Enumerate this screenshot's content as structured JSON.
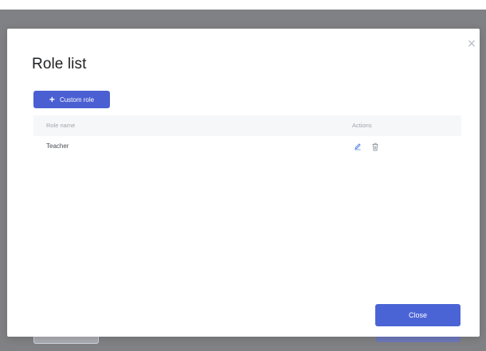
{
  "dialog": {
    "title": "Role list",
    "close_symbol": "×",
    "add_button": {
      "icon": "plus-icon",
      "label": "Custom role"
    },
    "table": {
      "columns": [
        "Role name",
        "Actions"
      ],
      "rows": [
        {
          "name": "Teacher",
          "actions": [
            "edit-icon",
            "delete-icon"
          ]
        }
      ]
    },
    "footer": {
      "close_label": "Close"
    }
  },
  "colors": {
    "overlay": "#808184",
    "primary": "#4a5fd2",
    "header_bg": "#f6f7f9",
    "icon_blue": "#5b86e5",
    "icon_grey": "#9aa0a8"
  }
}
